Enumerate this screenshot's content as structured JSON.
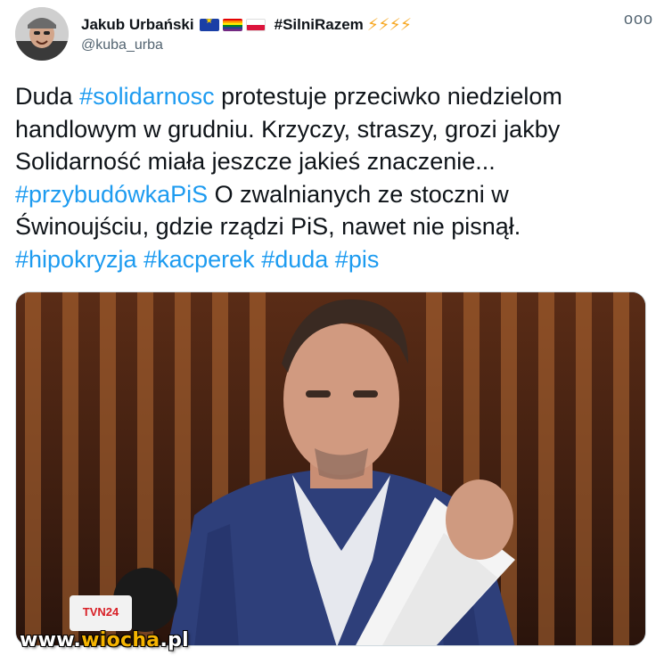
{
  "author": {
    "display_name": "Jakub Urbański",
    "tag": "#SilniRazem",
    "bolts": "⚡⚡⚡⚡",
    "handle": "@kuba_urba"
  },
  "more_label": "ooo",
  "tweet": {
    "line1": {
      "t1": "Duda ",
      "h1": "#solidarnosc",
      "t2": " protestuje przeciwko niedzielom"
    },
    "line2": "handlowym w grudniu. Krzyczy, straszy, grozi jakby",
    "line3": "Solidarność miała jeszcze jakieś znaczenie...",
    "line4": {
      "h1": "#przybudówkaPiS",
      "t1": " O zwalnianych ze stoczni w"
    },
    "line5": "Świnoujściu, gdzie rządzi PiS, nawet nie pisnął.",
    "line6": {
      "h1": "#hipokryzja",
      "h2": "#kacperek",
      "h3": "#duda",
      "h4": "#pis"
    }
  },
  "media": {
    "mic_brand": "TVN24"
  },
  "watermark": {
    "prefix": "www.",
    "brand": "wiocha",
    "suffix": ".pl"
  },
  "colors": {
    "link": "#1d9bf0",
    "text": "#0f1419",
    "secondary": "#536471",
    "bolt": "#f7a823"
  }
}
